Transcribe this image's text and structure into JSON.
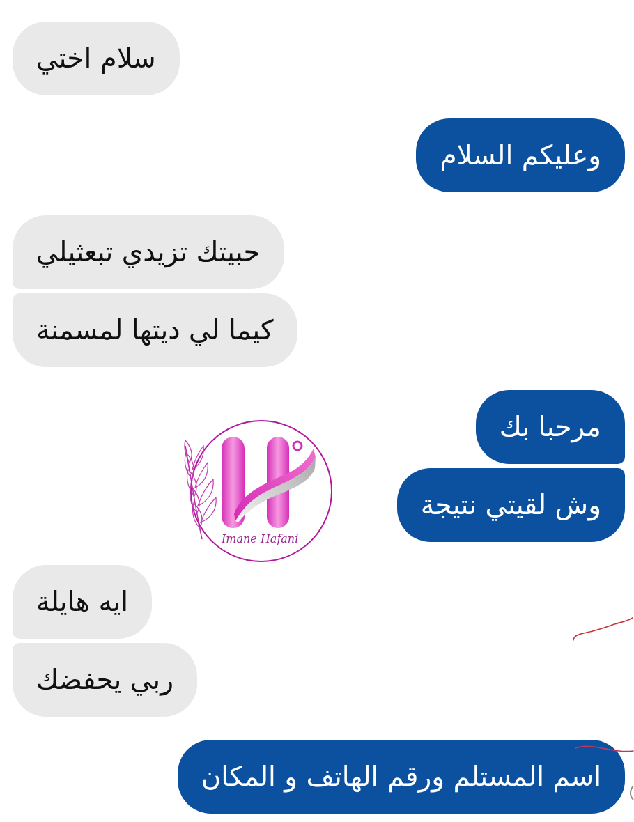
{
  "groups": [
    {
      "kind": "received",
      "messages": [
        "سلام اختي"
      ]
    },
    {
      "kind": "sent",
      "messages": [
        "وعليكم السلام"
      ]
    },
    {
      "kind": "received",
      "messages": [
        "حبيتك تزيدي تبعثيلي",
        "كيما لي ديتها لمسمنة"
      ]
    },
    {
      "kind": "sent",
      "messages": [
        "مرحبا بك",
        "وش لقيتي نتيجة"
      ]
    },
    {
      "kind": "received",
      "messages": [
        "ايه هايلة",
        "ربي يحفضك"
      ]
    },
    {
      "kind": "sent",
      "messages": [
        "اسم المستلم ورقم الهاتف و المكان"
      ]
    }
  ],
  "logo": {
    "text": "Imane Hafani"
  }
}
